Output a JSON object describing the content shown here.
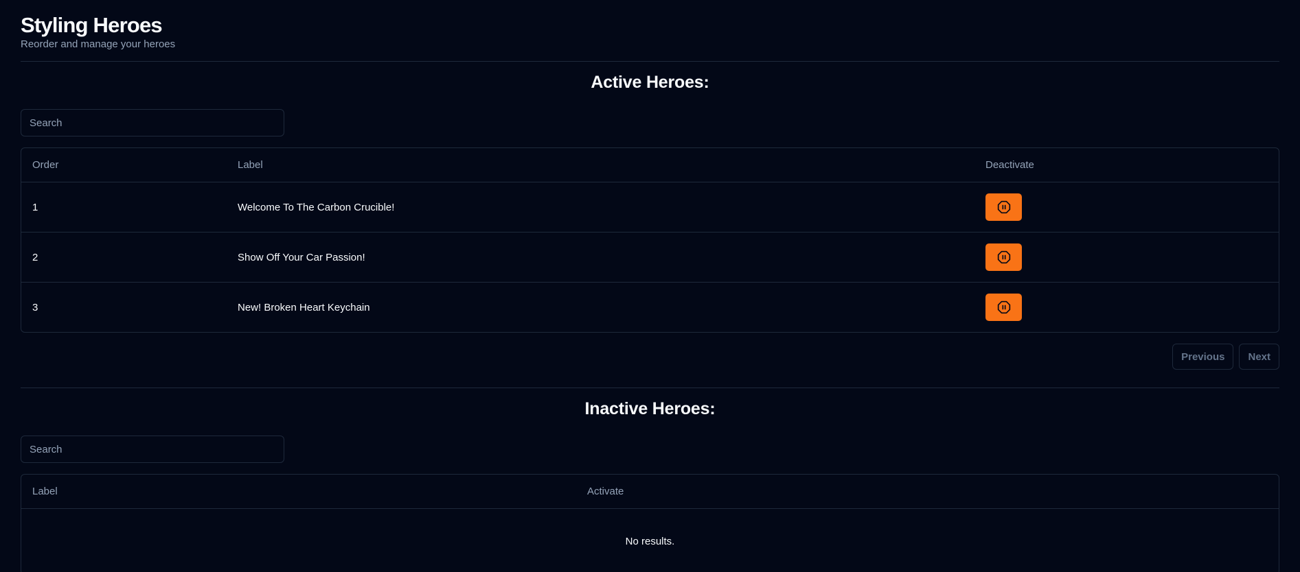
{
  "header": {
    "title": "Styling Heroes",
    "subtitle": "Reorder and manage your heroes"
  },
  "active": {
    "title": "Active Heroes:",
    "search_placeholder": "Search",
    "columns": {
      "order": "Order",
      "label": "Label",
      "action": "Deactivate"
    },
    "rows": [
      {
        "order": "1",
        "label": "Welcome To The Carbon Crucible!"
      },
      {
        "order": "2",
        "label": "Show Off Your Car Passion!"
      },
      {
        "order": "3",
        "label": "New! Broken Heart Keychain"
      }
    ],
    "action_icon": "pause-octagon-icon",
    "pagination": {
      "previous": "Previous",
      "next": "Next"
    }
  },
  "inactive": {
    "title": "Inactive Heroes:",
    "search_placeholder": "Search",
    "columns": {
      "label": "Label",
      "action": "Activate"
    },
    "empty_message": "No results."
  },
  "colors": {
    "background": "#030817",
    "border": "#1e293b",
    "accent": "#f97316",
    "muted_text": "#94a3b8"
  }
}
